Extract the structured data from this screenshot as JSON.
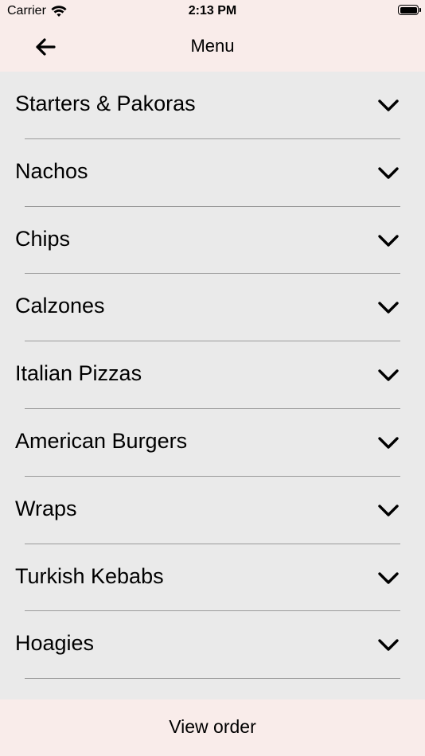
{
  "status_bar": {
    "carrier": "Carrier",
    "time": "2:13 PM"
  },
  "nav": {
    "title": "Menu",
    "back_icon": "arrow-left-icon"
  },
  "categories": [
    {
      "label": "Starters & Pakoras"
    },
    {
      "label": "Nachos"
    },
    {
      "label": "Chips"
    },
    {
      "label": "Calzones"
    },
    {
      "label": "Italian Pizzas"
    },
    {
      "label": "American Burgers"
    },
    {
      "label": "Wraps"
    },
    {
      "label": "Turkish Kebabs"
    },
    {
      "label": "Hoagies"
    }
  ],
  "footer": {
    "button_label": "View order"
  },
  "colors": {
    "bar_background": "#f9ecea",
    "list_background": "#eaeaea",
    "divider": "#9a9a9a",
    "text": "#000000"
  }
}
